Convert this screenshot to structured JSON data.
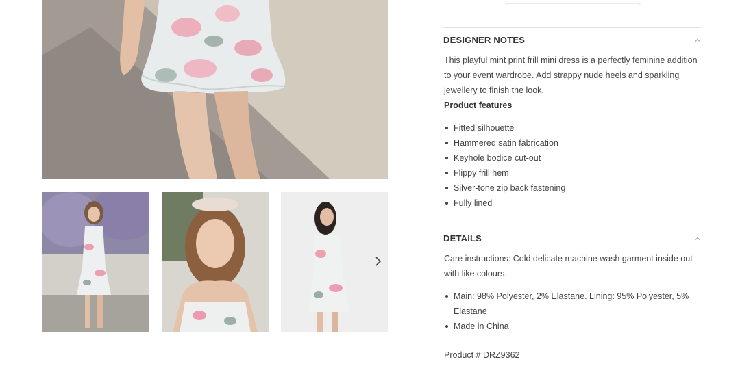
{
  "gallery": {
    "main_image_name": "model in floral frill mini dress, skirt close-up",
    "thumbnails": [
      "model standing by lavender hedge",
      "model wearing floral headpiece",
      "model full-length studio shot"
    ],
    "next_icon": "chevron-right-icon"
  },
  "designer_notes": {
    "title": "DESIGNER NOTES",
    "description": "This playful mint print frill mini dress is a perfectly feminine addition to your event wardrobe. Add strappy nude heels and sparkling jewellery to finish the look.",
    "features_heading": "Product features",
    "features": [
      "Fitted silhouette",
      "Hammered satin fabrication",
      "Keyhole bodice cut-out",
      "Flippy frill hem",
      "Silver-tone zip back fastening",
      "Fully lined"
    ],
    "toggle_icon": "chevron-up-icon"
  },
  "details": {
    "title": "DETAILS",
    "care": "Care instructions: Cold delicate machine wash garment inside out with like colours.",
    "items": [
      "Main: 98% Polyester, 2% Elastane. Lining: 95% Polyester, 5% Elastane",
      "Made in China"
    ],
    "product_number": "Product # DRZ9362",
    "toggle_icon": "chevron-up-icon"
  },
  "colors": {
    "divider": "#e3e3e3",
    "text": "#444444",
    "heading": "#333333"
  }
}
